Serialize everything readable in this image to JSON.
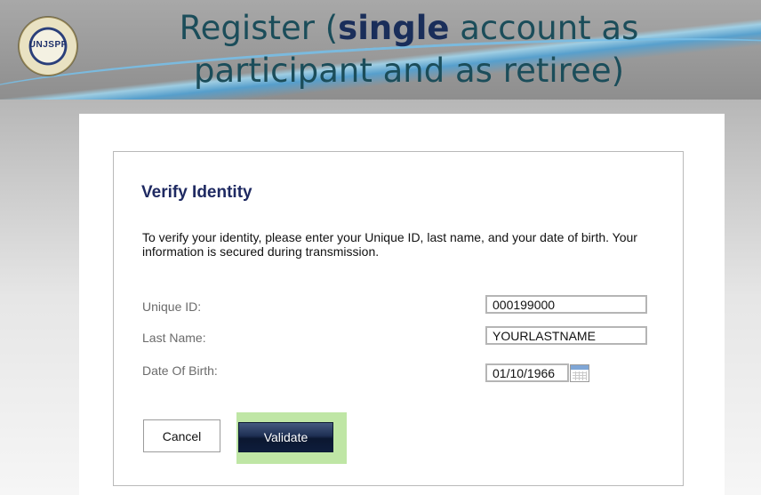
{
  "header": {
    "logo_text": "UNJSPF",
    "title_prefix": "Register (",
    "title_bold": "single",
    "title_rest": " account as participant and as retiree)"
  },
  "form": {
    "heading": "Verify Identity",
    "description": "To verify your identity, please enter your Unique ID, last name, and your date of birth. Your information is secured during transmission.",
    "fields": [
      {
        "label": "Unique ID:",
        "value": "000199000"
      },
      {
        "label": "Last Name:",
        "value": "YOURLASTNAME"
      },
      {
        "label": "Date Of Birth:",
        "value": "01/10/1966"
      }
    ],
    "cancel_label": "Cancel",
    "validate_label": "Validate",
    "highlight_color": "#bfe6a5"
  }
}
